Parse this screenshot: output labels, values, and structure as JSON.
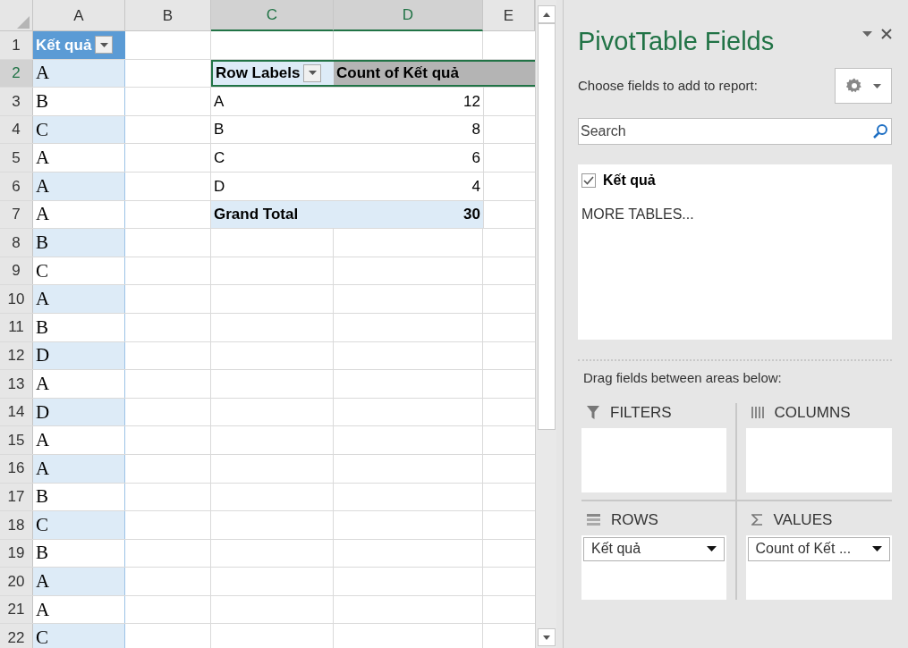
{
  "sheet": {
    "columns": [
      {
        "label": "A",
        "selected": false
      },
      {
        "label": "B",
        "selected": false
      },
      {
        "label": "C",
        "selected": true
      },
      {
        "label": "D",
        "selected": true
      },
      {
        "label": "E",
        "selected": false
      }
    ],
    "header_cell": {
      "text": "Kết quả"
    },
    "rows": [
      {
        "number": "1",
        "selected": false
      },
      {
        "number": "2",
        "selected": true,
        "value": "A"
      },
      {
        "number": "3",
        "selected": false,
        "value": "B"
      },
      {
        "number": "4",
        "selected": false,
        "value": "C"
      },
      {
        "number": "5",
        "selected": false,
        "value": "A"
      },
      {
        "number": "6",
        "selected": false,
        "value": "A"
      },
      {
        "number": "7",
        "selected": false,
        "value": "A"
      },
      {
        "number": "8",
        "selected": false,
        "value": "B"
      },
      {
        "number": "9",
        "selected": false,
        "value": "C"
      },
      {
        "number": "10",
        "selected": false,
        "value": "A"
      },
      {
        "number": "11",
        "selected": false,
        "value": "B"
      },
      {
        "number": "12",
        "selected": false,
        "value": "D"
      },
      {
        "number": "13",
        "selected": false,
        "value": "A"
      },
      {
        "number": "14",
        "selected": false,
        "value": "D"
      },
      {
        "number": "15",
        "selected": false,
        "value": "A"
      },
      {
        "number": "16",
        "selected": false,
        "value": "A"
      },
      {
        "number": "17",
        "selected": false,
        "value": "B"
      },
      {
        "number": "18",
        "selected": false,
        "value": "C"
      },
      {
        "number": "19",
        "selected": false,
        "value": "B"
      },
      {
        "number": "20",
        "selected": false,
        "value": "A"
      },
      {
        "number": "21",
        "selected": false,
        "value": "A"
      },
      {
        "number": "22",
        "selected": false,
        "value": "C"
      }
    ],
    "pivot": {
      "header": [
        "Row Labels",
        "Count of Kết quả"
      ],
      "rows": [
        {
          "label": "A",
          "count": "12",
          "kind": "item"
        },
        {
          "label": "B",
          "count": "8",
          "kind": "item"
        },
        {
          "label": "C",
          "count": "6",
          "kind": "item"
        },
        {
          "label": "D",
          "count": "4",
          "kind": "item"
        },
        {
          "label": "Grand Total",
          "count": "30",
          "kind": "total"
        }
      ]
    }
  },
  "panel": {
    "title": "PivotTable Fields",
    "subtitle": "Choose fields to add to report:",
    "search": {
      "placeholder": "Search"
    },
    "fields": [
      {
        "label": "Kết quả",
        "checked": true
      }
    ],
    "more_tables": "MORE TABLES...",
    "areas_hint": "Drag fields between areas below:",
    "areas": [
      {
        "kind": "filters",
        "label": "FILTERS"
      },
      {
        "kind": "columns",
        "label": "COLUMNS"
      },
      {
        "kind": "rows",
        "label": "ROWS",
        "items": [
          "Kết quả"
        ]
      },
      {
        "kind": "values",
        "label": "VALUES",
        "items": [
          "Count of Kết ..."
        ]
      }
    ]
  }
}
